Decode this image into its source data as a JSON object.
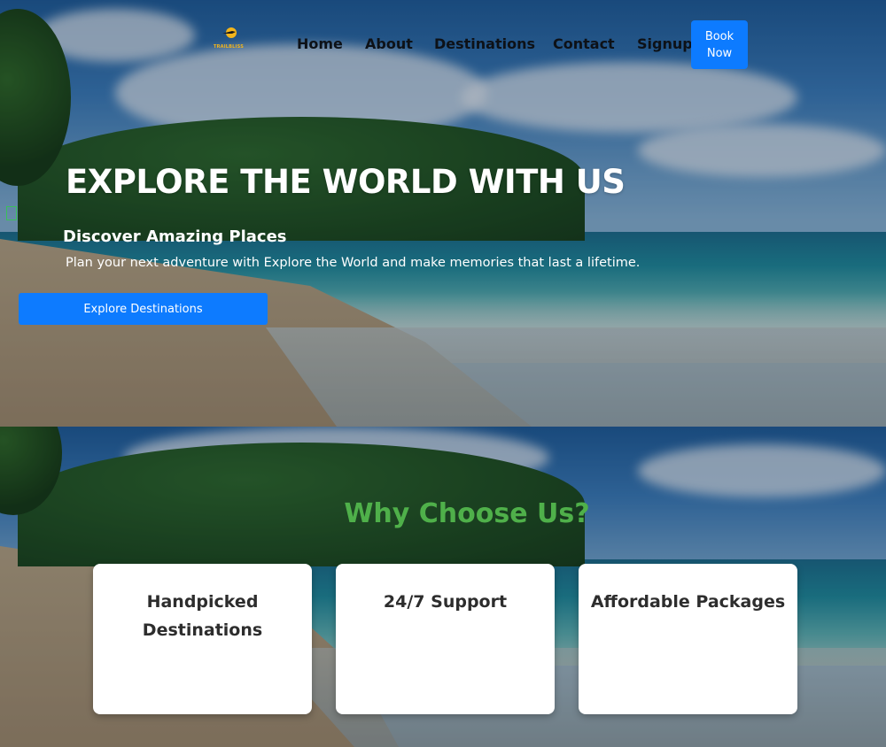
{
  "header": {
    "logo_text": "TRAILBLISS",
    "nav": [
      "Home",
      "About",
      "Destinations",
      "Contact",
      "Signup"
    ],
    "book_button": "Book Now"
  },
  "hero": {
    "title": "EXPLORE THE WORLD WITH US",
    "subtitle": "Discover Amazing Places",
    "description": "Plan your next adventure with Explore the World and make memories that last a lifetime.",
    "cta": "Explore Destinations"
  },
  "why": {
    "title": "Why Choose Us?",
    "cards": [
      "Handpicked Destinations",
      "24/7 Support",
      "Affordable Packages"
    ]
  },
  "colors": {
    "primary_button": "#0d7bff",
    "why_title": "#4fb04a",
    "logo": "#f3b51b"
  },
  "icons": [
    "airplane-logo-icon"
  ]
}
